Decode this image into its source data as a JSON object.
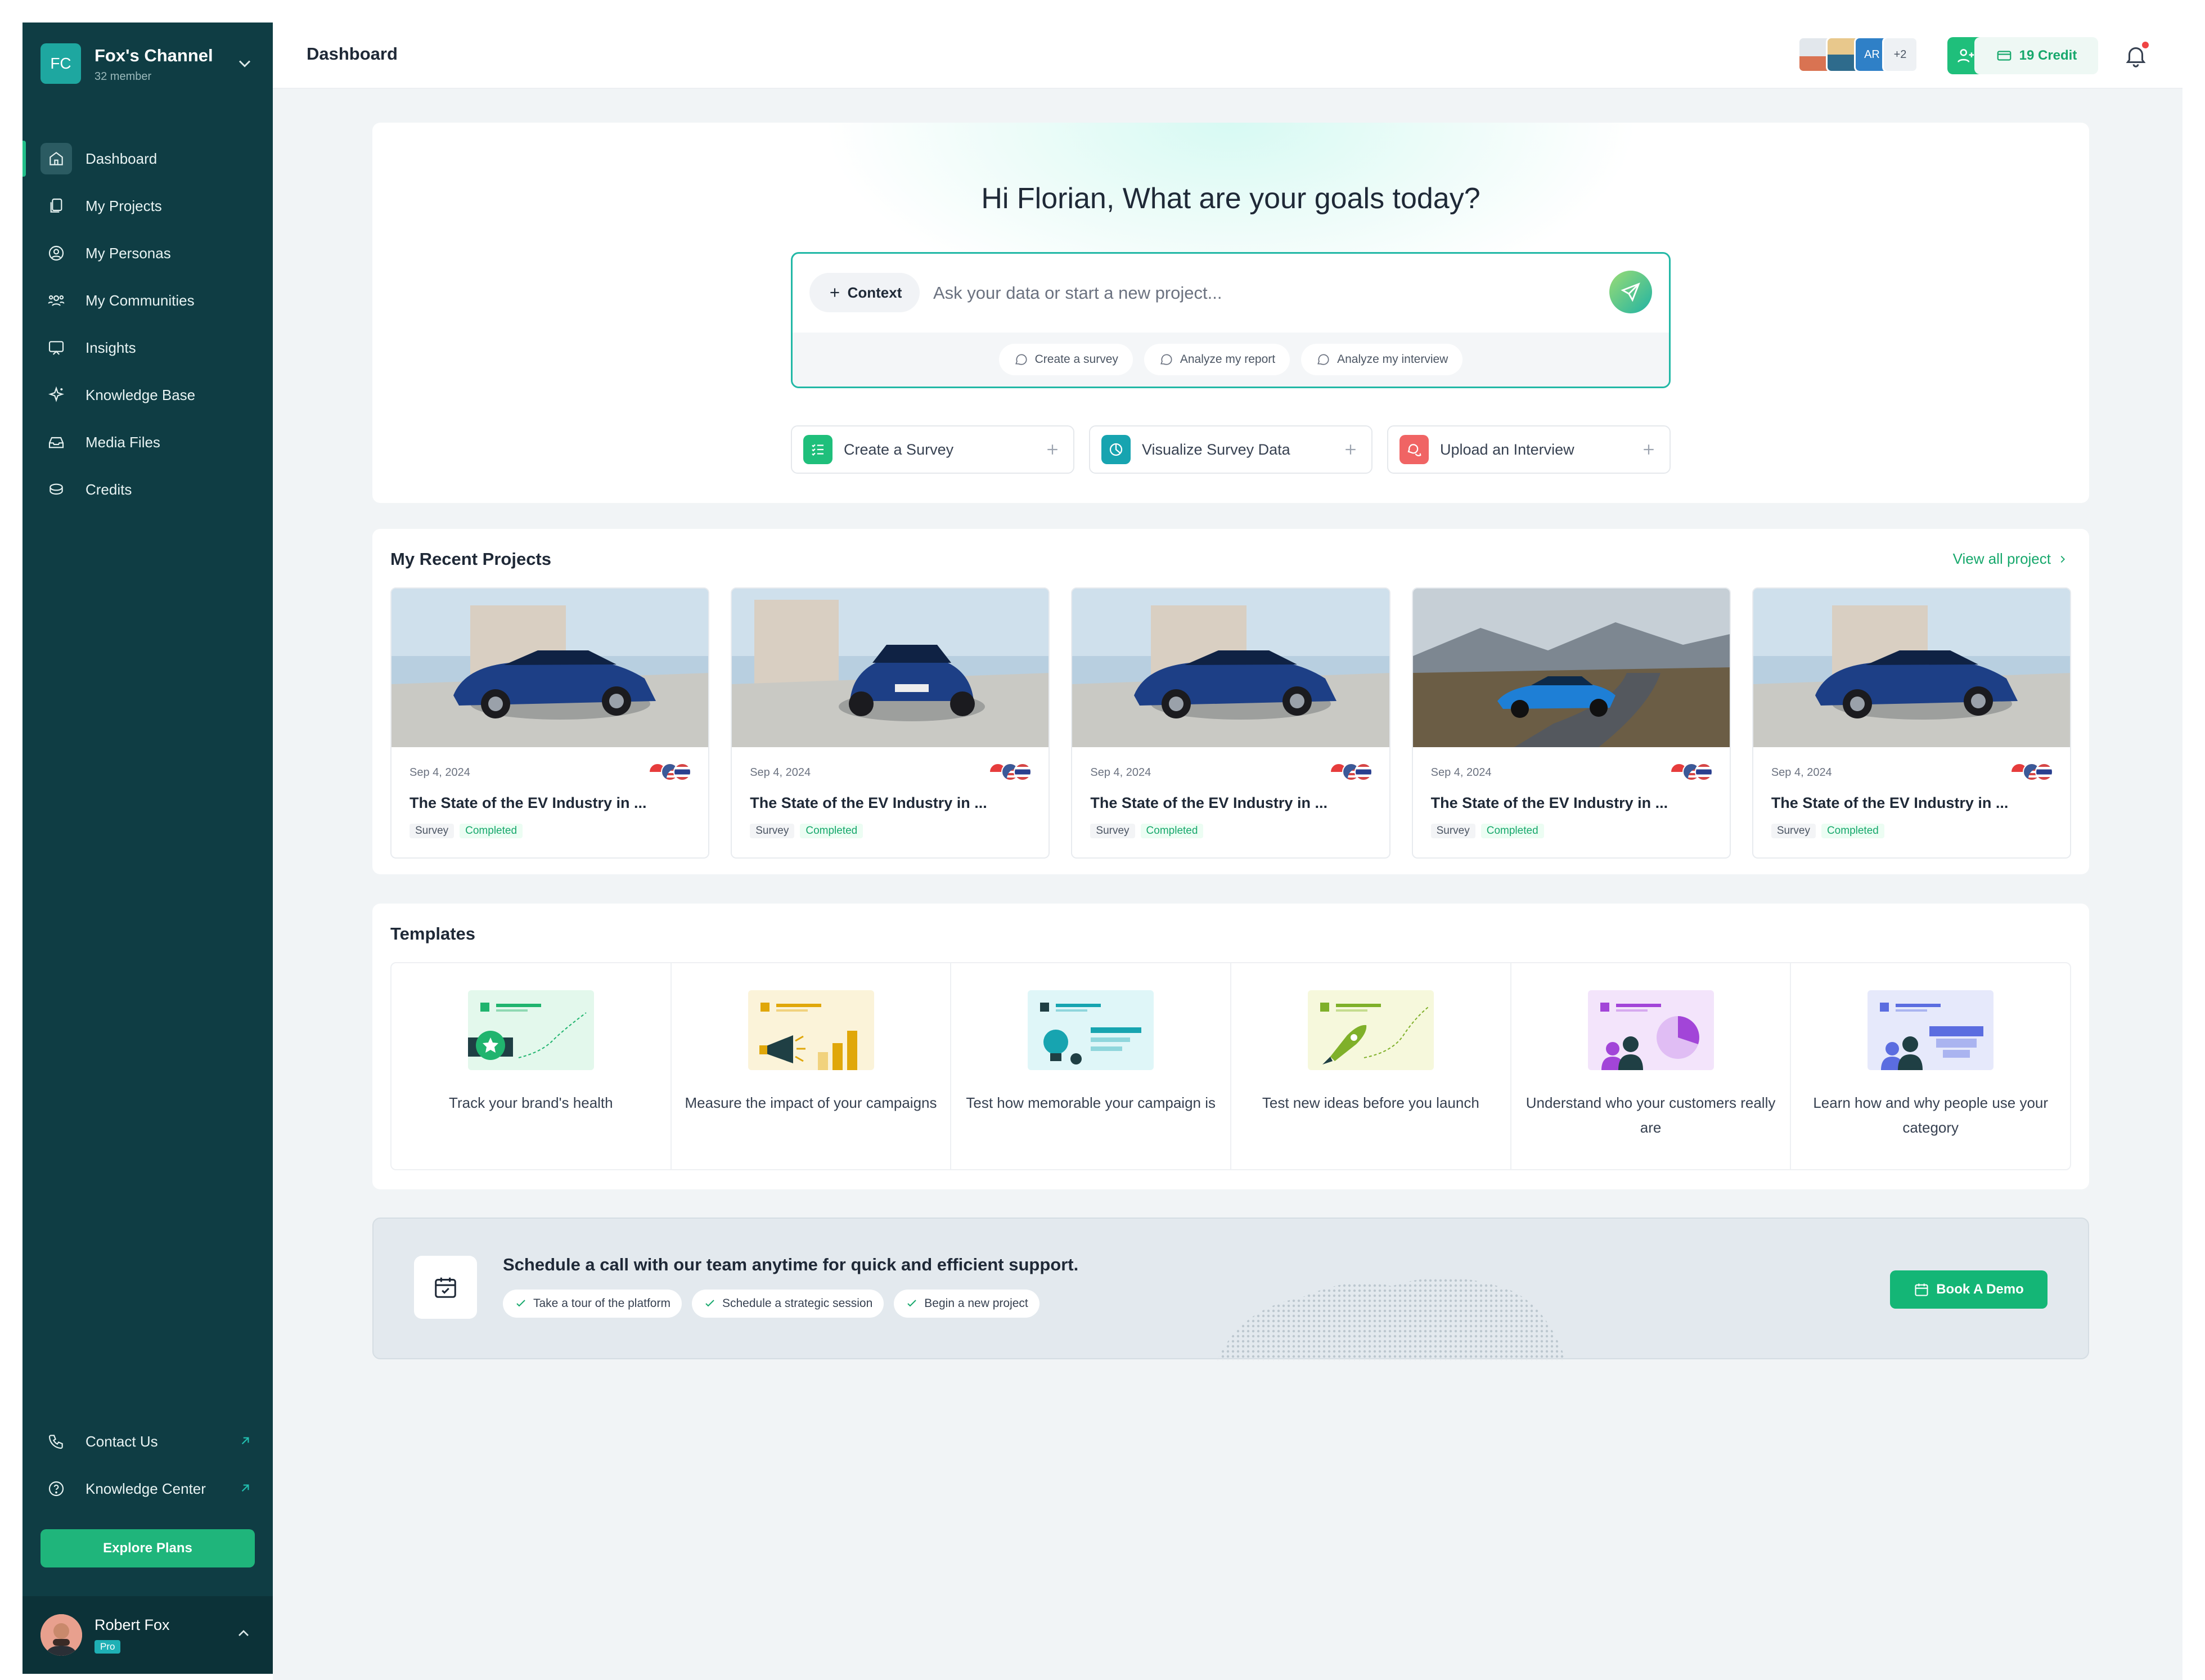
{
  "workspace": {
    "initials": "FC",
    "name": "Fox's Channel",
    "members": "32 member"
  },
  "nav": [
    {
      "label": "Dashboard",
      "icon": "home-icon"
    },
    {
      "label": "My Projects",
      "icon": "projects-icon"
    },
    {
      "label": "My Personas",
      "icon": "persona-icon"
    },
    {
      "label": "My Communities",
      "icon": "communities-icon"
    },
    {
      "label": "Insights",
      "icon": "insights-icon"
    },
    {
      "label": "Knowledge Base",
      "icon": "sparkle-icon"
    },
    {
      "label": "Media Files",
      "icon": "media-icon"
    },
    {
      "label": "Credits",
      "icon": "coins-icon"
    }
  ],
  "sidebar_bottom": {
    "contact": "Contact Us",
    "knowledge_center": "Knowledge Center",
    "explore": "Explore Plans"
  },
  "user": {
    "name": "Robert Fox",
    "plan": "Pro"
  },
  "header": {
    "title": "Dashboard",
    "avatar_initials": "AR",
    "avatar_more": "+2",
    "credit": "19 Credit"
  },
  "hero": {
    "title": "Hi Florian, What are your goals today?",
    "context_label": "Context",
    "placeholder": "Ask your data or start a new project...",
    "suggestions": [
      "Create a survey",
      "Analyze my report",
      "Analyze my interview"
    ],
    "actions": [
      "Create a Survey",
      "Visualize Survey Data",
      "Upload an Interview"
    ]
  },
  "recent": {
    "title": "My Recent Projects",
    "view_all": "View all project",
    "projects": [
      {
        "date": "Sep 4, 2024",
        "title": "The State of the EV Industry in ...",
        "type": "Survey",
        "status": "Completed"
      },
      {
        "date": "Sep 4, 2024",
        "title": "The State of the EV Industry in ...",
        "type": "Survey",
        "status": "Completed"
      },
      {
        "date": "Sep 4, 2024",
        "title": "The State of the EV Industry in ...",
        "type": "Survey",
        "status": "Completed"
      },
      {
        "date": "Sep 4, 2024",
        "title": "The State of the EV Industry in ...",
        "type": "Survey",
        "status": "Completed"
      },
      {
        "date": "Sep 4, 2024",
        "title": "The State of the EV Industry in ...",
        "type": "Survey",
        "status": "Completed"
      }
    ]
  },
  "templates": {
    "title": "Templates",
    "items": [
      "Track your brand's health",
      "Measure the impact of your campaigns",
      "Test how memorable your campaign is",
      "Test new ideas before you launch",
      "Understand who your customers really are",
      "Learn how and why people use your category"
    ]
  },
  "demo": {
    "title": "Schedule a call with our team anytime for quick and efficient support.",
    "chips": [
      "Take a tour of the platform",
      "Schedule a strategic session",
      "Begin a new project"
    ],
    "button": "Book A Demo"
  },
  "colors": {
    "sidebar": "#0f3d44",
    "accent": "#1fb57b",
    "hero_border": "#22b8a6"
  }
}
